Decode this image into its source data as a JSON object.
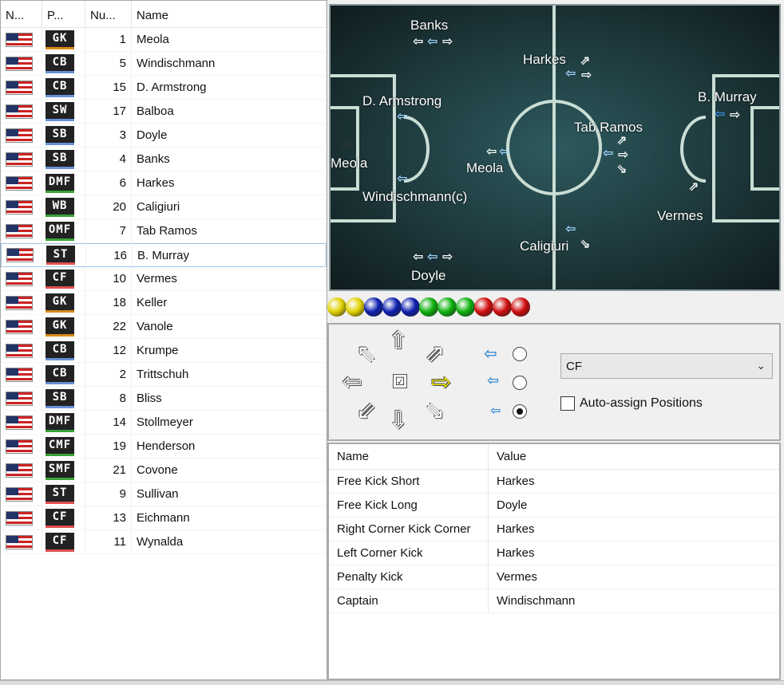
{
  "roster": {
    "headers": [
      "N...",
      "P...",
      "Nu...",
      "Name"
    ],
    "rows": [
      {
        "pos": "GK",
        "group": "gk",
        "num": "1",
        "name": "Meola"
      },
      {
        "pos": "CB",
        "group": "def",
        "num": "5",
        "name": "Windischmann"
      },
      {
        "pos": "CB",
        "group": "def",
        "num": "15",
        "name": "D. Armstrong"
      },
      {
        "pos": "SW",
        "group": "def",
        "num": "17",
        "name": "Balboa"
      },
      {
        "pos": "SB",
        "group": "def",
        "num": "3",
        "name": "Doyle"
      },
      {
        "pos": "SB",
        "group": "def",
        "num": "4",
        "name": "Banks"
      },
      {
        "pos": "DMF",
        "group": "mid",
        "num": "6",
        "name": "Harkes"
      },
      {
        "pos": "WB",
        "group": "mid",
        "num": "20",
        "name": "Caligiuri"
      },
      {
        "pos": "OMF",
        "group": "mid",
        "num": "7",
        "name": "Tab Ramos"
      },
      {
        "pos": "ST",
        "group": "att",
        "num": "16",
        "name": "B. Murray"
      },
      {
        "pos": "CF",
        "group": "att",
        "num": "10",
        "name": "Vermes"
      },
      {
        "pos": "GK",
        "group": "gk",
        "num": "18",
        "name": "Keller"
      },
      {
        "pos": "GK",
        "group": "gk",
        "num": "22",
        "name": "Vanole"
      },
      {
        "pos": "CB",
        "group": "def",
        "num": "12",
        "name": "Krumpe"
      },
      {
        "pos": "CB",
        "group": "def",
        "num": "2",
        "name": "Trittschuh"
      },
      {
        "pos": "SB",
        "group": "def",
        "num": "8",
        "name": "Bliss"
      },
      {
        "pos": "DMF",
        "group": "mid",
        "num": "14",
        "name": "Stollmeyer"
      },
      {
        "pos": "CMF",
        "group": "mid",
        "num": "19",
        "name": "Henderson"
      },
      {
        "pos": "SMF",
        "group": "mid",
        "num": "21",
        "name": "Covone"
      },
      {
        "pos": "ST",
        "group": "att",
        "num": "9",
        "name": "Sullivan"
      },
      {
        "pos": "CF",
        "group": "att",
        "num": "13",
        "name": "Eichmann"
      },
      {
        "pos": "CF",
        "group": "att",
        "num": "11",
        "name": "Wynalda"
      }
    ]
  },
  "pitch": {
    "players": [
      {
        "label": "Banks",
        "color": "blue"
      },
      {
        "label": "Harkes",
        "color": "green"
      },
      {
        "label": "D. Armstrong",
        "color": "blue"
      },
      {
        "label": "B. Murray",
        "color": "white"
      },
      {
        "label": "Tab Ramos",
        "color": "green"
      },
      {
        "label": "Meola",
        "color": "yellow"
      },
      {
        "label": "Meola",
        "color": "green"
      },
      {
        "label": "Windischmann(c)",
        "color": "blue"
      },
      {
        "label": "Vermes",
        "color": "red"
      },
      {
        "label": "Caligiuri",
        "color": "green"
      },
      {
        "label": "Doyle",
        "color": "blue"
      }
    ]
  },
  "strip": {
    "balls": [
      "#e0d000",
      "#e0d000",
      "#0c1fb0",
      "#0c1fb0",
      "#0c1fb0",
      "#0cb00c",
      "#0cb00c",
      "#0cb00c",
      "#d00c0c",
      "#d00c0c",
      "#d00c0c"
    ]
  },
  "controls": {
    "position_value": "CF",
    "auto_assign_label": "Auto-assign Positions",
    "checkbox_mark": "☑",
    "dir_glyphs": {
      "up": "⇧",
      "down": "⇩",
      "left": "⇦",
      "right": "⇨",
      "ul": "⇖",
      "ur": "⇗",
      "dl": "⇙",
      "dr": "⇘"
    }
  },
  "properties": {
    "headers": [
      "Name",
      "Value"
    ],
    "rows": [
      {
        "name": "Free Kick Short",
        "value": "Harkes"
      },
      {
        "name": "Free Kick Long",
        "value": "Doyle"
      },
      {
        "name": "Right Corner Kick Corner",
        "value": "Harkes"
      },
      {
        "name": "Left Corner Kick",
        "value": "Harkes"
      },
      {
        "name": "Penalty Kick",
        "value": "Vermes"
      },
      {
        "name": "Captain",
        "value": "Windischmann"
      }
    ]
  }
}
